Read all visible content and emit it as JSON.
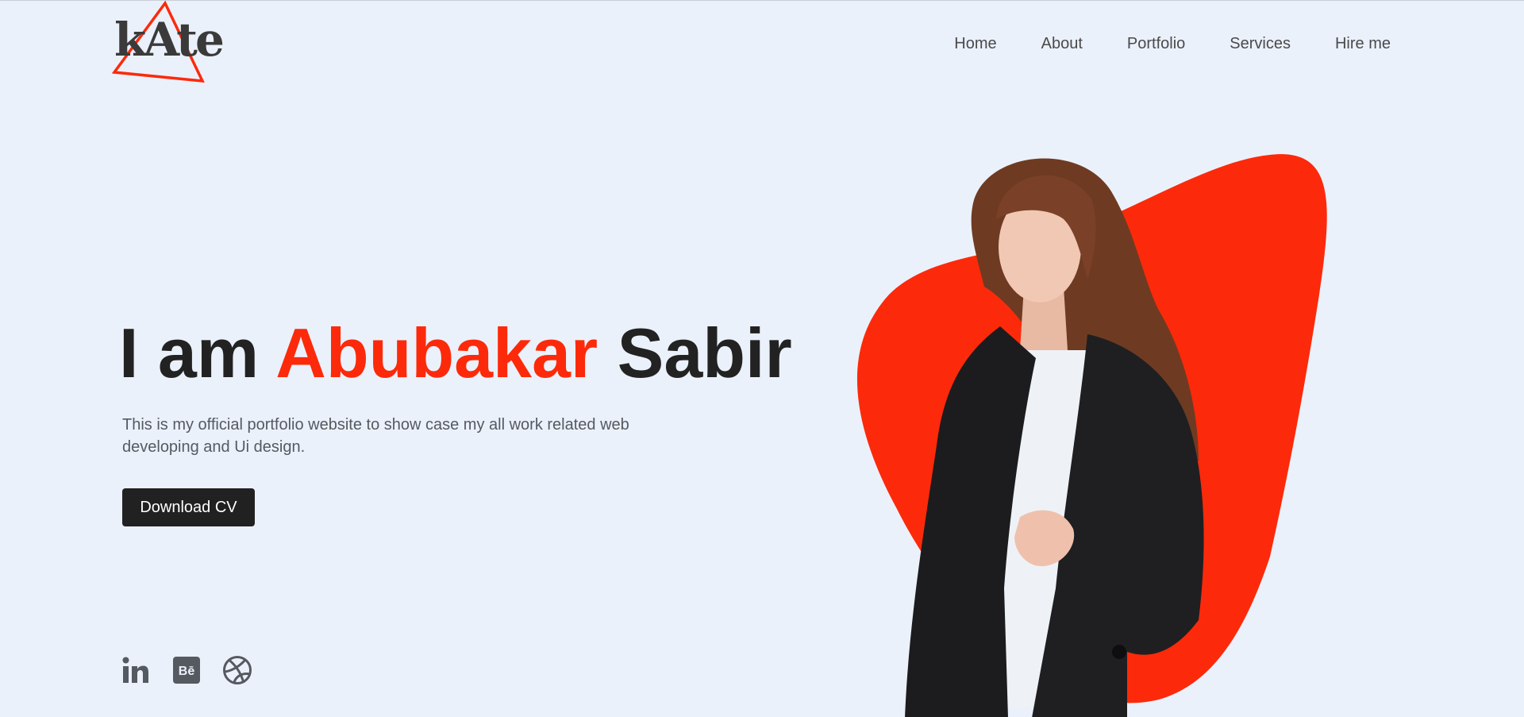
{
  "brand": {
    "logo_text": "kAte",
    "accent_color": "#fc2a0a"
  },
  "nav": {
    "items": [
      {
        "label": "Home"
      },
      {
        "label": "About"
      },
      {
        "label": "Portfolio"
      },
      {
        "label": "Services"
      },
      {
        "label": "Hire me"
      }
    ]
  },
  "hero": {
    "title_prefix": "I am",
    "title_name": "Abubakar",
    "title_suffix": "Sabir",
    "description": "This is my official portfolio website to show case my all work related web developing and Ui design.",
    "cta_label": "Download CV"
  },
  "socials": [
    {
      "icon": "linkedin-icon"
    },
    {
      "icon": "behance-icon"
    },
    {
      "icon": "dribbble-icon"
    }
  ],
  "colors": {
    "background": "#ebf1fb",
    "text_dark": "#222222",
    "button_bg": "#212121",
    "blob": "#fc2a0a"
  }
}
